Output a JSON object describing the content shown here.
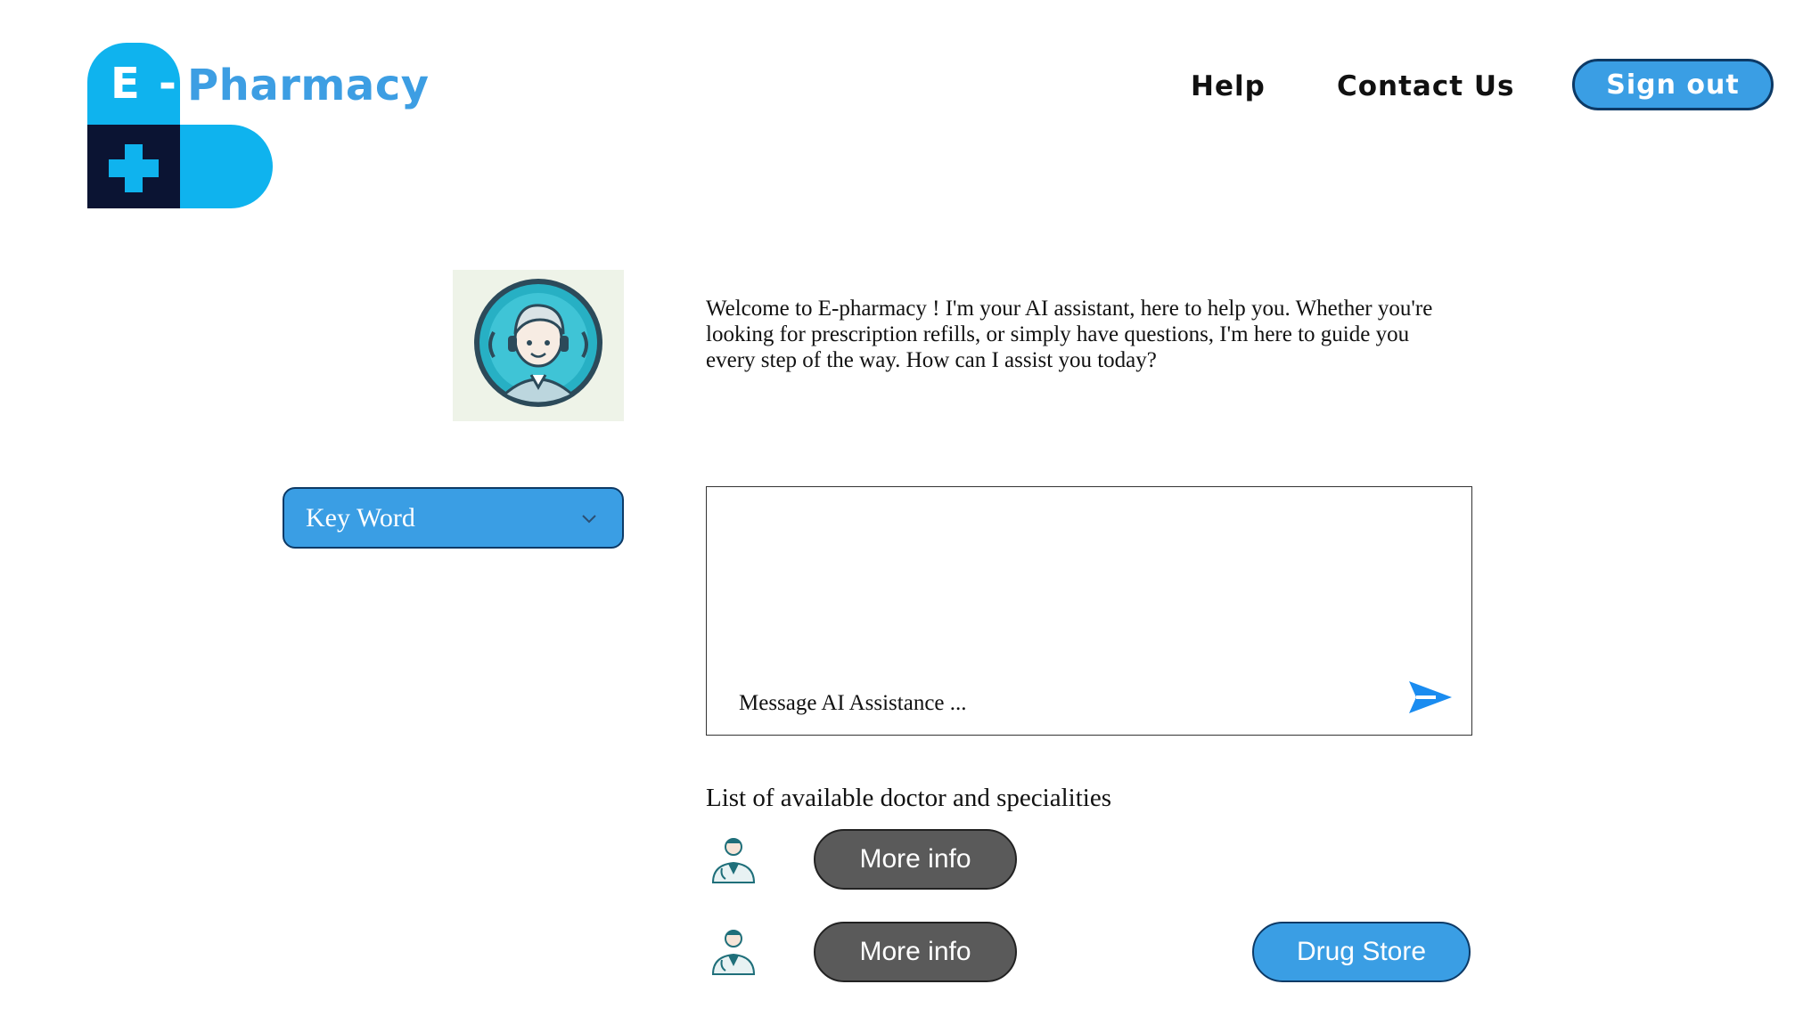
{
  "logo": {
    "letter": "E",
    "dash": "-",
    "word": "Pharmacy"
  },
  "nav": {
    "help": "Help",
    "contact": "Contact Us",
    "signout": "Sign out"
  },
  "assistant": {
    "avatar_icon": "ai-assistant-avatar-icon",
    "welcome": "Welcome to E-pharmacy ! I'm your AI assistant, here to help you. Whether you're looking for prescription refills, or simply have questions, I'm here to guide you every step of the way. How can I assist you today?"
  },
  "keyword_select": {
    "selected": "Key Word",
    "icon": "chevron-down-icon"
  },
  "chat": {
    "placeholder": "Message AI Assistance ...",
    "value": "",
    "send_icon": "send-icon"
  },
  "doctors": {
    "heading": "List of available doctor and specialities",
    "items": [
      {
        "icon": "doctor-icon",
        "button": "More info"
      },
      {
        "icon": "doctor-icon",
        "button": "More info"
      }
    ]
  },
  "drug_store": {
    "label": "Drug Store"
  },
  "colors": {
    "accent": "#3a9ee4",
    "logo_blue": "#0fb3ee",
    "logo_dark": "#0b1433",
    "gray_button": "#5a5a5a",
    "send_blue": "#1a8cf0"
  }
}
